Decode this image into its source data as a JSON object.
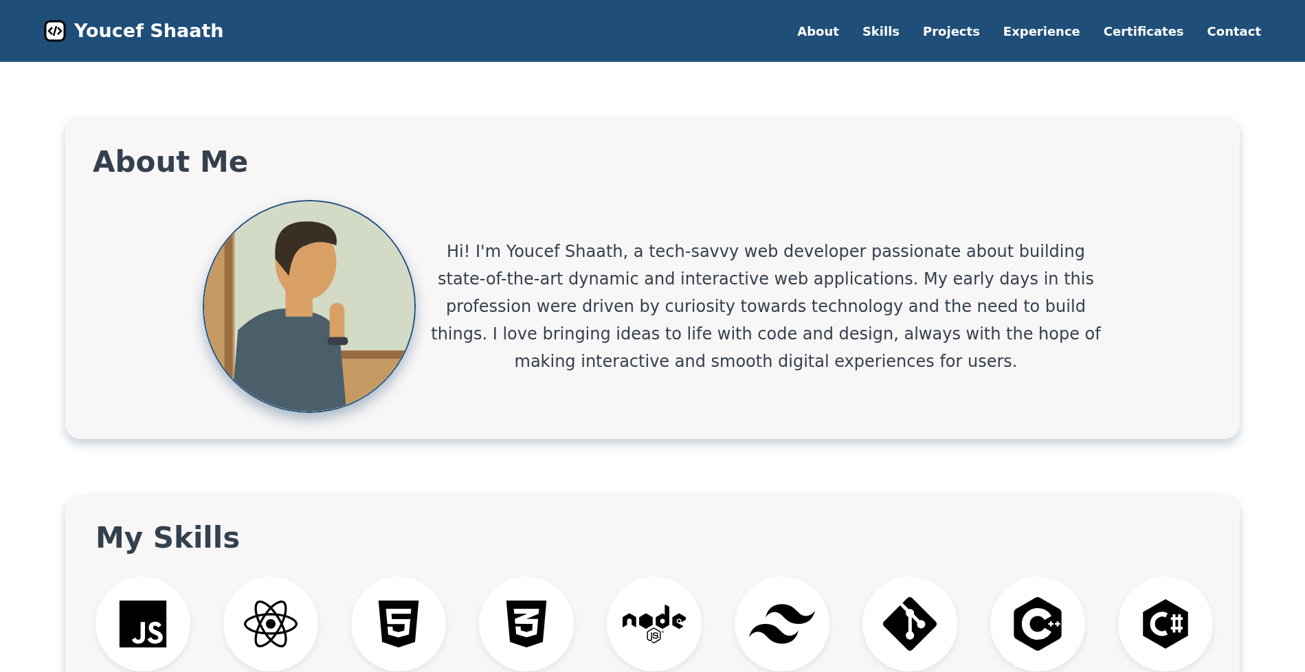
{
  "navbar": {
    "brand": "Youcef Shaath",
    "links": [
      "About",
      "Skills",
      "Projects",
      "Experience",
      "Certificates",
      "Contact"
    ]
  },
  "about": {
    "title": "About Me",
    "text": "Hi! I'm Youcef Shaath, a tech-savvy web developer passionate about building state-of-the-art dynamic and interactive web applications. My early days in this profession were driven by curiosity towards technology and the need to build things. I love bringing ideas to life with code and design, always with the hope of making interactive and smooth digital experiences for users."
  },
  "skills": {
    "title": "My Skills",
    "items": [
      {
        "kind": "javascript"
      },
      {
        "kind": "react"
      },
      {
        "kind": "html"
      },
      {
        "kind": "css"
      },
      {
        "kind": "node"
      },
      {
        "kind": "tailwind"
      },
      {
        "kind": "git"
      },
      {
        "kind": "cpp"
      },
      {
        "kind": "csharp"
      }
    ]
  }
}
